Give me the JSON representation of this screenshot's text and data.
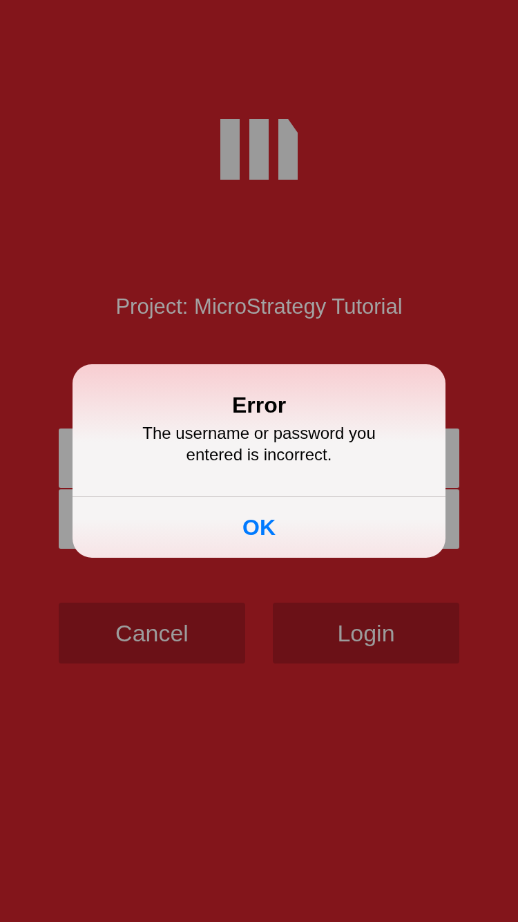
{
  "project_label": "Project: MicroStrategy Tutorial",
  "buttons": [
    "Cancel",
    "Login"
  ],
  "alert": {
    "title": "Error",
    "message": "The username or password you entered is incorrect.",
    "button": "OK"
  }
}
